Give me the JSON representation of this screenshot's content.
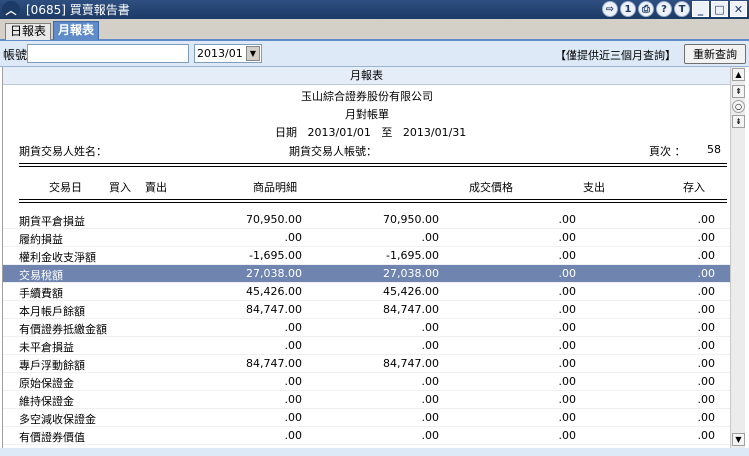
{
  "window": {
    "title": "[0685] 買賣報告書",
    "controls": [
      "⇨",
      "1",
      "⎙",
      "?",
      "T",
      "_",
      "□",
      "✕"
    ]
  },
  "tabs": [
    {
      "label": "日報表",
      "active": false
    },
    {
      "label": "月報表",
      "active": true
    }
  ],
  "filter": {
    "account_label": "帳號",
    "account_value": "",
    "month_value": "2013/01",
    "note": "【僅提供近三個月查詢】",
    "refresh_label": "重新查詢"
  },
  "report": {
    "header": "月報表",
    "company": "玉山綜合證券股份有限公司",
    "statement": "月對帳單",
    "date_label": "日期",
    "date_from": "2013/01/01",
    "date_sep": "至",
    "date_to": "2013/01/31",
    "trader_name_label": "期貨交易人姓名：",
    "trader_account_label": "期貨交易人帳號：",
    "page_label": "頁次 ：",
    "page_value": "58",
    "columns": [
      "交易日",
      "買入",
      "賣出",
      "商品明細",
      "成交價格",
      "支出",
      "存入"
    ],
    "rows": [
      {
        "label": "期貨平倉損益",
        "v1": "70,950.00",
        "v2": "70,950.00",
        "v3": ".00",
        "v4": ".00",
        "selected": false
      },
      {
        "label": "履約損益",
        "v1": ".00",
        "v2": ".00",
        "v3": ".00",
        "v4": ".00",
        "selected": false
      },
      {
        "label": "權利金收支淨額",
        "v1": "-1,695.00",
        "v2": "-1,695.00",
        "v3": ".00",
        "v4": ".00",
        "selected": false
      },
      {
        "label": "交易稅額",
        "v1": "27,038.00",
        "v2": "27,038.00",
        "v3": ".00",
        "v4": ".00",
        "selected": true
      },
      {
        "label": "手續費額",
        "v1": "45,426.00",
        "v2": "45,426.00",
        "v3": ".00",
        "v4": ".00",
        "selected": false
      },
      {
        "label": "本月帳戶餘額",
        "v1": "84,747.00",
        "v2": "84,747.00",
        "v3": ".00",
        "v4": ".00",
        "selected": false
      },
      {
        "label": "有價證券抵繳金額",
        "v1": ".00",
        "v2": ".00",
        "v3": ".00",
        "v4": ".00",
        "selected": false
      },
      {
        "label": "未平倉損益",
        "v1": ".00",
        "v2": ".00",
        "v3": ".00",
        "v4": ".00",
        "selected": false
      },
      {
        "label": "專戶浮動餘額",
        "v1": "84,747.00",
        "v2": "84,747.00",
        "v3": ".00",
        "v4": ".00",
        "selected": false
      },
      {
        "label": "原始保證金",
        "v1": ".00",
        "v2": ".00",
        "v3": ".00",
        "v4": ".00",
        "selected": false
      },
      {
        "label": "維持保證金",
        "v1": ".00",
        "v2": ".00",
        "v3": ".00",
        "v4": ".00",
        "selected": false
      },
      {
        "label": "多空減收保證金",
        "v1": ".00",
        "v2": ".00",
        "v3": ".00",
        "v4": ".00",
        "selected": false
      },
      {
        "label": "有價證券價值",
        "v1": ".00",
        "v2": ".00",
        "v3": ".00",
        "v4": ".00",
        "selected": false
      }
    ]
  },
  "colors": {
    "titlebar": "#1d3a66",
    "active_tab": "#5f8cc8",
    "selected_row": "#6f84ae",
    "filter_bg": "#dde9f6"
  }
}
